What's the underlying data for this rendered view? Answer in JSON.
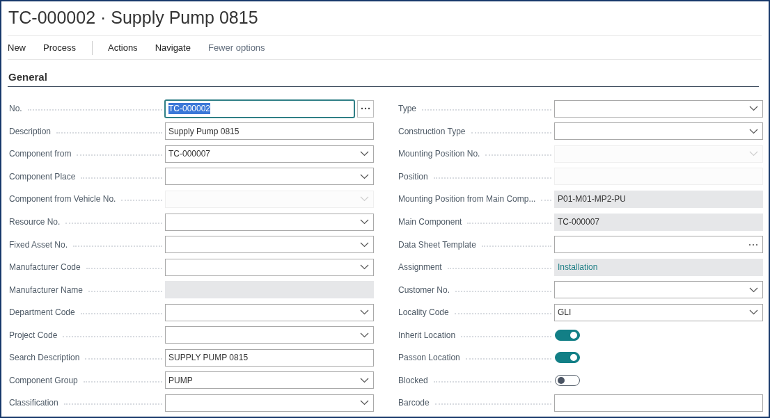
{
  "title": "TC-000002 · Supply Pump 0815",
  "actions": [
    {
      "label": "New",
      "muted": false,
      "divider_after": false
    },
    {
      "label": "Process",
      "muted": false,
      "divider_after": true
    },
    {
      "label": "Actions",
      "muted": false,
      "divider_after": false
    },
    {
      "label": "Navigate",
      "muted": false,
      "divider_after": false
    },
    {
      "label": "Fewer options",
      "muted": true,
      "divider_after": false
    }
  ],
  "section": {
    "title": "General"
  },
  "left_fields": [
    {
      "label": "No.",
      "kind": "text",
      "value": "TC-000002",
      "focused": true,
      "assist": true
    },
    {
      "label": "Description",
      "kind": "text",
      "value": "Supply Pump 0815"
    },
    {
      "label": "Component from",
      "kind": "select",
      "value": "TC-000007"
    },
    {
      "label": "Component Place",
      "kind": "select"
    },
    {
      "label": "Component from Vehicle No.",
      "kind": "select",
      "disabled": true
    },
    {
      "label": "Resource No.",
      "kind": "select"
    },
    {
      "label": "Fixed Asset No.",
      "kind": "select"
    },
    {
      "label": "Manufacturer Code",
      "kind": "select"
    },
    {
      "label": "Manufacturer Name",
      "kind": "readonly"
    },
    {
      "label": "Department Code",
      "kind": "select"
    },
    {
      "label": "Project Code",
      "kind": "select"
    },
    {
      "label": "Search Description",
      "kind": "text",
      "value": "SUPPLY PUMP 0815"
    },
    {
      "label": "Component Group",
      "kind": "select",
      "value": "PUMP"
    },
    {
      "label": "Classification",
      "kind": "select"
    }
  ],
  "right_fields": [
    {
      "label": "Type",
      "kind": "select"
    },
    {
      "label": "Construction Type",
      "kind": "select"
    },
    {
      "label": "Mounting Position No.",
      "kind": "select",
      "disabled": true
    },
    {
      "label": "Position",
      "kind": "text",
      "disabled": true
    },
    {
      "label": "Mounting Position from Main Comp...",
      "kind": "readonly",
      "value": "P01-M01-MP2-PU"
    },
    {
      "label": "Main Component",
      "kind": "readonly",
      "value": "TC-000007"
    },
    {
      "label": "Data Sheet Template",
      "kind": "lookup"
    },
    {
      "label": "Assignment",
      "kind": "readonly",
      "value": "Installation",
      "link": true
    },
    {
      "label": "Customer No.",
      "kind": "select"
    },
    {
      "label": "Locality Code",
      "kind": "select",
      "value": "GLI"
    },
    {
      "label": "Inherit Location",
      "kind": "toggle",
      "on": true
    },
    {
      "label": "Passon Location",
      "kind": "toggle",
      "on": true
    },
    {
      "label": "Blocked",
      "kind": "toggle",
      "on": false
    },
    {
      "label": "Barcode",
      "kind": "text"
    }
  ]
}
